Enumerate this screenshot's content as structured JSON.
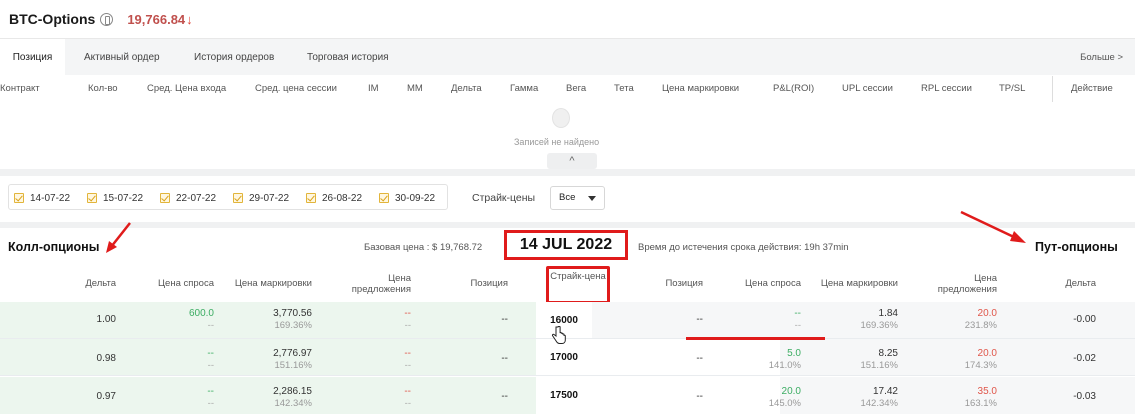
{
  "header": {
    "title": "BTC-Options",
    "price": "19,766.84",
    "price_arrow": "↓",
    "info_icon": "info-icon"
  },
  "tabs": [
    {
      "label": "Позиция",
      "active": true
    },
    {
      "label": "Активный ордер",
      "active": false
    },
    {
      "label": "История ордеров",
      "active": false
    },
    {
      "label": "Торговая история",
      "active": false
    }
  ],
  "more_label": "Больше >",
  "positions": {
    "columns": [
      "Контракт",
      "Кол-во",
      "Сред. Цена входа",
      "Сред. цена сессии",
      "IM",
      "MM",
      "Дельта",
      "Гамма",
      "Вега",
      "Тета",
      "Цена маркировки",
      "P&L(ROI)",
      "UPL сессии",
      "RPL сессии",
      "TP/SL",
      "Действие"
    ],
    "empty_text": "Записей не найдено",
    "collapse_glyph": "^"
  },
  "filters": {
    "dates": [
      "14-07-22",
      "15-07-22",
      "22-07-22",
      "29-07-22",
      "26-08-22",
      "30-09-22"
    ],
    "strike_label": "Страйк-цены",
    "strike_value": "Все"
  },
  "chain": {
    "calls_title": "Колл-опционы",
    "puts_title": "Пут-опционы",
    "base_price": "Базовая цена : $ 19,768.72",
    "date": "14 JUL 2022",
    "expiry": "Время до истечения срока действия:  19h 37min",
    "call_headers": [
      "Дельта",
      "Цена спроса",
      "Цена маркировки",
      "Цена предложения",
      "Позиция"
    ],
    "strike_header": "Страйк-цена",
    "put_headers": [
      "Позиция",
      "Цена спроса",
      "Цена маркировки",
      "Цена предложения",
      "Дельта"
    ],
    "rows": [
      {
        "strike": "16000",
        "call_delta": "1.00",
        "call_bid": "600.0",
        "call_bid_sub": "--",
        "call_mark": "3,770.56",
        "call_mark_sub": "169.36%",
        "call_ask": "--",
        "call_ask_sub": "--",
        "call_pos": "--",
        "put_pos": "--",
        "put_bid": "--",
        "put_bid_sub": "--",
        "put_mark": "1.84",
        "put_mark_sub": "169.36%",
        "put_ask": "20.0",
        "put_ask_sub": "231.8%",
        "put_delta": "-0.00"
      },
      {
        "strike": "17000",
        "call_delta": "0.98",
        "call_bid": "--",
        "call_bid_sub": "--",
        "call_mark": "2,776.97",
        "call_mark_sub": "151.16%",
        "call_ask": "--",
        "call_ask_sub": "--",
        "call_pos": "--",
        "put_pos": "--",
        "put_bid": "5.0",
        "put_bid_sub": "141.0%",
        "put_mark": "8.25",
        "put_mark_sub": "151.16%",
        "put_ask": "20.0",
        "put_ask_sub": "174.3%",
        "put_delta": "-0.02"
      },
      {
        "strike": "17500",
        "call_delta": "0.97",
        "call_bid": "--",
        "call_bid_sub": "--",
        "call_mark": "2,286.15",
        "call_mark_sub": "142.34%",
        "call_ask": "--",
        "call_ask_sub": "--",
        "call_pos": "--",
        "put_pos": "--",
        "put_bid": "20.0",
        "put_bid_sub": "145.0%",
        "put_mark": "17.42",
        "put_mark_sub": "142.34%",
        "put_ask": "35.0",
        "put_ask_sub": "163.1%",
        "put_delta": "-0.03"
      }
    ]
  },
  "colors": {
    "accent_red": "#e01b1b",
    "price_red": "#c0504d",
    "bid_green": "#3cad63",
    "ask_red": "#e0564a",
    "call_row_bg": "#ecf6ee",
    "checkbox_yellow": "#e2b53b"
  }
}
